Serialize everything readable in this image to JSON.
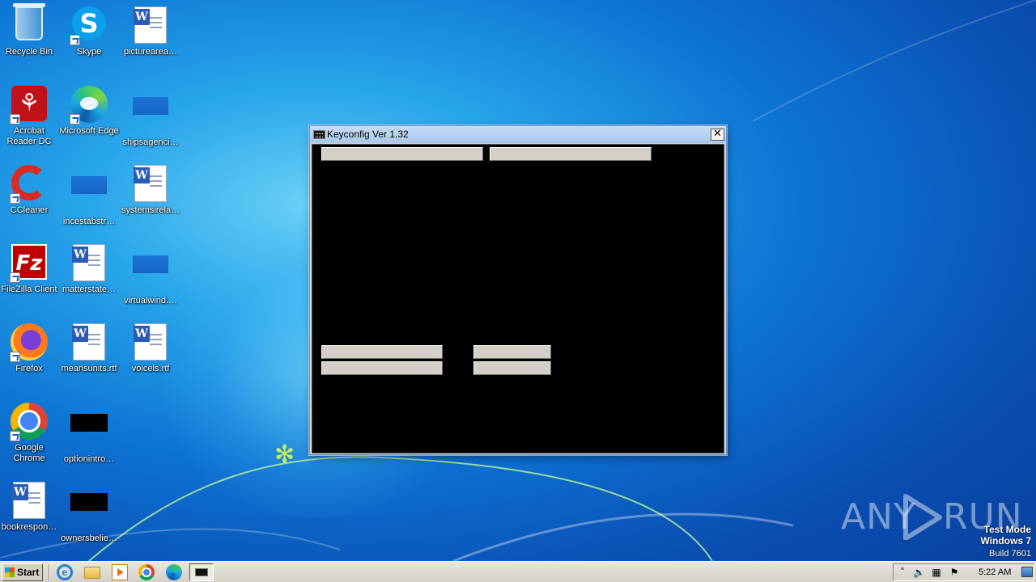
{
  "desktop": {
    "icons": [
      {
        "label": "Recycle Bin",
        "icon": "recycle-bin-icon"
      },
      {
        "label": "Skype",
        "icon": "skype-icon"
      },
      {
        "label": "picturearea…",
        "icon": "word-document-icon"
      },
      {
        "label": "Acrobat Reader DC",
        "icon": "acrobat-icon"
      },
      {
        "label": "Microsoft Edge",
        "icon": "edge-icon"
      },
      {
        "label": "shipsagenci…",
        "icon": "blank-file-icon"
      },
      {
        "label": "CCleaner",
        "icon": "ccleaner-icon"
      },
      {
        "label": "incestabstr…",
        "icon": "blank-file-icon"
      },
      {
        "label": "systemsirela…",
        "icon": "word-document-icon"
      },
      {
        "label": "FileZilla Client",
        "icon": "filezilla-icon"
      },
      {
        "label": "matterstate…",
        "icon": "word-document-icon"
      },
      {
        "label": "virtualwind.…",
        "icon": "blank-file-icon"
      },
      {
        "label": "Firefox",
        "icon": "firefox-icon"
      },
      {
        "label": "meansunits.rtf",
        "icon": "word-document-icon"
      },
      {
        "label": "voicels.rtf",
        "icon": "word-document-icon"
      },
      {
        "label": "Google Chrome",
        "icon": "chrome-icon"
      },
      {
        "label": "optionintro…",
        "icon": "black-thumbnail-icon"
      },
      {
        "label": "bookrespon…",
        "icon": "word-document-icon"
      },
      {
        "label": "ownersbelie…",
        "icon": "black-thumbnail-icon"
      }
    ]
  },
  "window": {
    "title": "Keyconfig Ver 1.32",
    "close_symbol": "✕",
    "buttons": [
      {
        "name": "top-button-1",
        "label": ""
      },
      {
        "name": "top-button-2",
        "label": ""
      },
      {
        "name": "button-left-1",
        "label": ""
      },
      {
        "name": "button-left-2",
        "label": ""
      },
      {
        "name": "button-right-1",
        "label": ""
      },
      {
        "name": "button-right-2",
        "label": ""
      }
    ]
  },
  "watermark": {
    "brand_left": "ANY",
    "brand_right": "RUN",
    "line1": "Test Mode",
    "line2": "Windows 7",
    "line3": "Build 7601"
  },
  "taskbar": {
    "start_label": "Start",
    "pinned": [
      "internet-explorer-icon",
      "folder-icon",
      "media-player-icon",
      "chrome-icon",
      "edge-icon"
    ],
    "active_task": "keyconfig-task-icon",
    "tray": {
      "chevron": "˄",
      "clock": "5:22 AM"
    }
  },
  "colors": {
    "wallpaper": "#0d74d3",
    "window_client": "#000000",
    "button_face": "#d4d0c8"
  }
}
